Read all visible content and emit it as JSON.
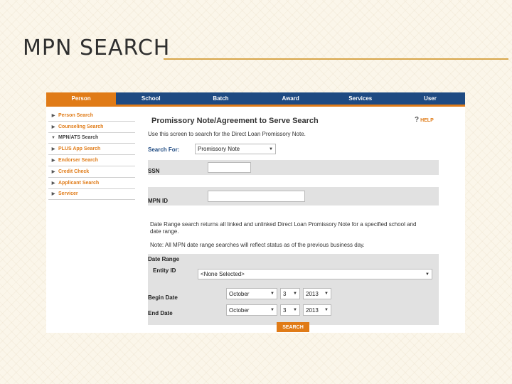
{
  "slide": {
    "title": "MPN SEARCH"
  },
  "nav": {
    "tabs": [
      {
        "label": "Person"
      },
      {
        "label": "School"
      },
      {
        "label": "Batch"
      },
      {
        "label": "Award"
      },
      {
        "label": "Services"
      },
      {
        "label": "User"
      }
    ],
    "active_tab": "Person"
  },
  "sidebar": {
    "items": [
      {
        "label": "Person Search"
      },
      {
        "label": "Counseling Search"
      },
      {
        "label": "MPN/ATS Search"
      },
      {
        "label": "PLUS App Search"
      },
      {
        "label": "Endorser Search"
      },
      {
        "label": "Credit Check"
      },
      {
        "label": "Applicant Search"
      },
      {
        "label": "Servicer"
      }
    ],
    "current_item": "MPN/ATS Search"
  },
  "main": {
    "heading": "Promissory Note/Agreement to Serve Search",
    "help_label": "HELP",
    "intro": "Use this screen to search for the Direct Loan Promissory Note.",
    "search_for_label": "Search For:",
    "search_for_value": "Promissory Note",
    "ssn_label": "SSN",
    "ssn_value": "",
    "mpn_id_label": "MPN ID",
    "mpn_id_value": "",
    "note_1": "Date Range search returns all linked and unlinked Direct Loan Promissory Note for a specified school and date range.",
    "note_2": "Note: All MPN date range searches will reflect status as of the previous business day.",
    "date_range_label": "Date Range",
    "entity_id_label": "Entity ID",
    "entity_id_value": "<None Selected>",
    "begin_date_label": "Begin Date",
    "begin_month": "October",
    "begin_day": "3",
    "begin_year": "2013",
    "end_date_label": "End Date",
    "end_month": "October",
    "end_day": "3",
    "end_year": "2013",
    "search_button": "SEARCH"
  },
  "colors": {
    "nav_blue": "#1e4a82",
    "accent_orange": "#e07b17",
    "title_rule": "#d8a64a",
    "band_gray": "#e1e1e1"
  }
}
